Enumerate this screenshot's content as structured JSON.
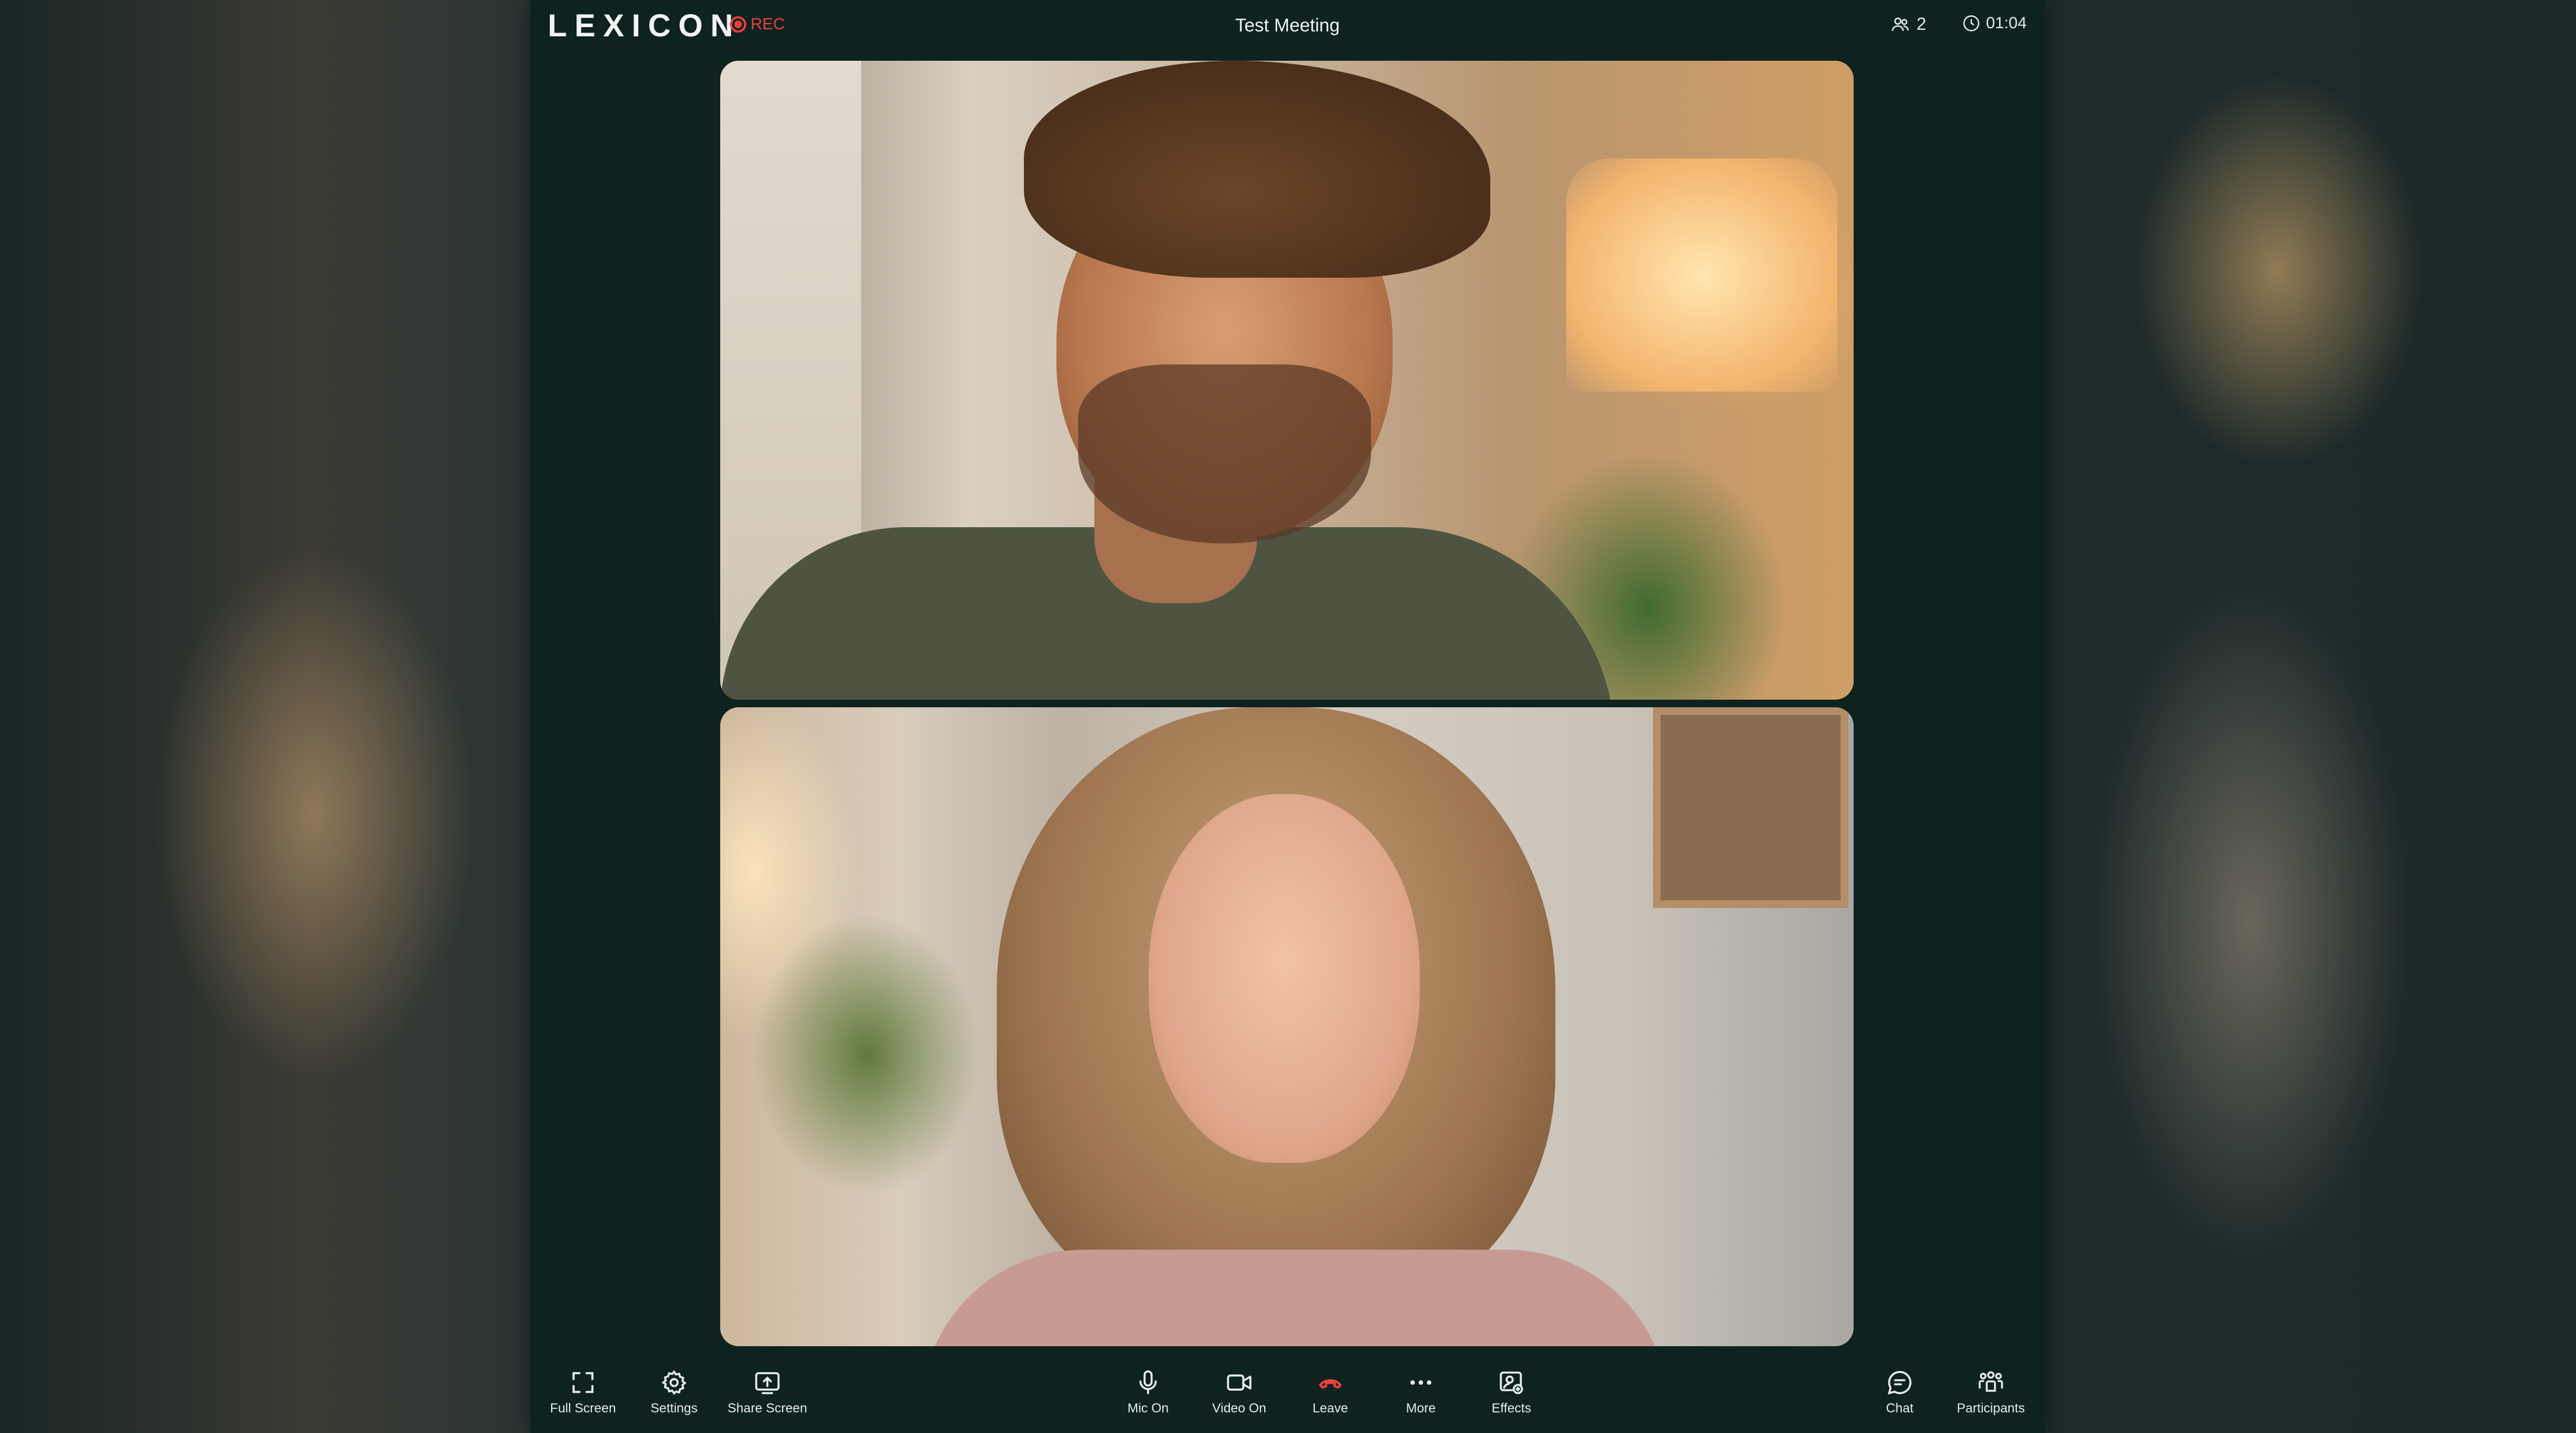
{
  "header": {
    "logo": "LEXICON",
    "rec_label": "REC",
    "meeting_title": "Test Meeting",
    "participant_count": "2",
    "elapsed_time": "01:04"
  },
  "video_tiles": [
    {
      "name": "participant-video-1"
    },
    {
      "name": "participant-video-2"
    }
  ],
  "toolbar": {
    "left": [
      {
        "label": "Full Screen",
        "icon": "fullscreen-icon"
      },
      {
        "label": "Settings",
        "icon": "gear-icon"
      },
      {
        "label": "Share Screen",
        "icon": "share-screen-icon"
      }
    ],
    "center": [
      {
        "label": "Mic On",
        "icon": "microphone-icon"
      },
      {
        "label": "Video On",
        "icon": "video-camera-icon"
      },
      {
        "label": "Leave",
        "icon": "hang-up-icon"
      },
      {
        "label": "More",
        "icon": "more-dots-icon"
      },
      {
        "label": "Effects",
        "icon": "effects-icon"
      }
    ],
    "right": [
      {
        "label": "Chat",
        "icon": "chat-icon"
      },
      {
        "label": "Participants",
        "icon": "participants-icon"
      }
    ]
  },
  "colors": {
    "app_background": "#0e2220",
    "rec_red": "#e8423a",
    "leave_red": "#e8423a",
    "text": "#e8eceb"
  }
}
